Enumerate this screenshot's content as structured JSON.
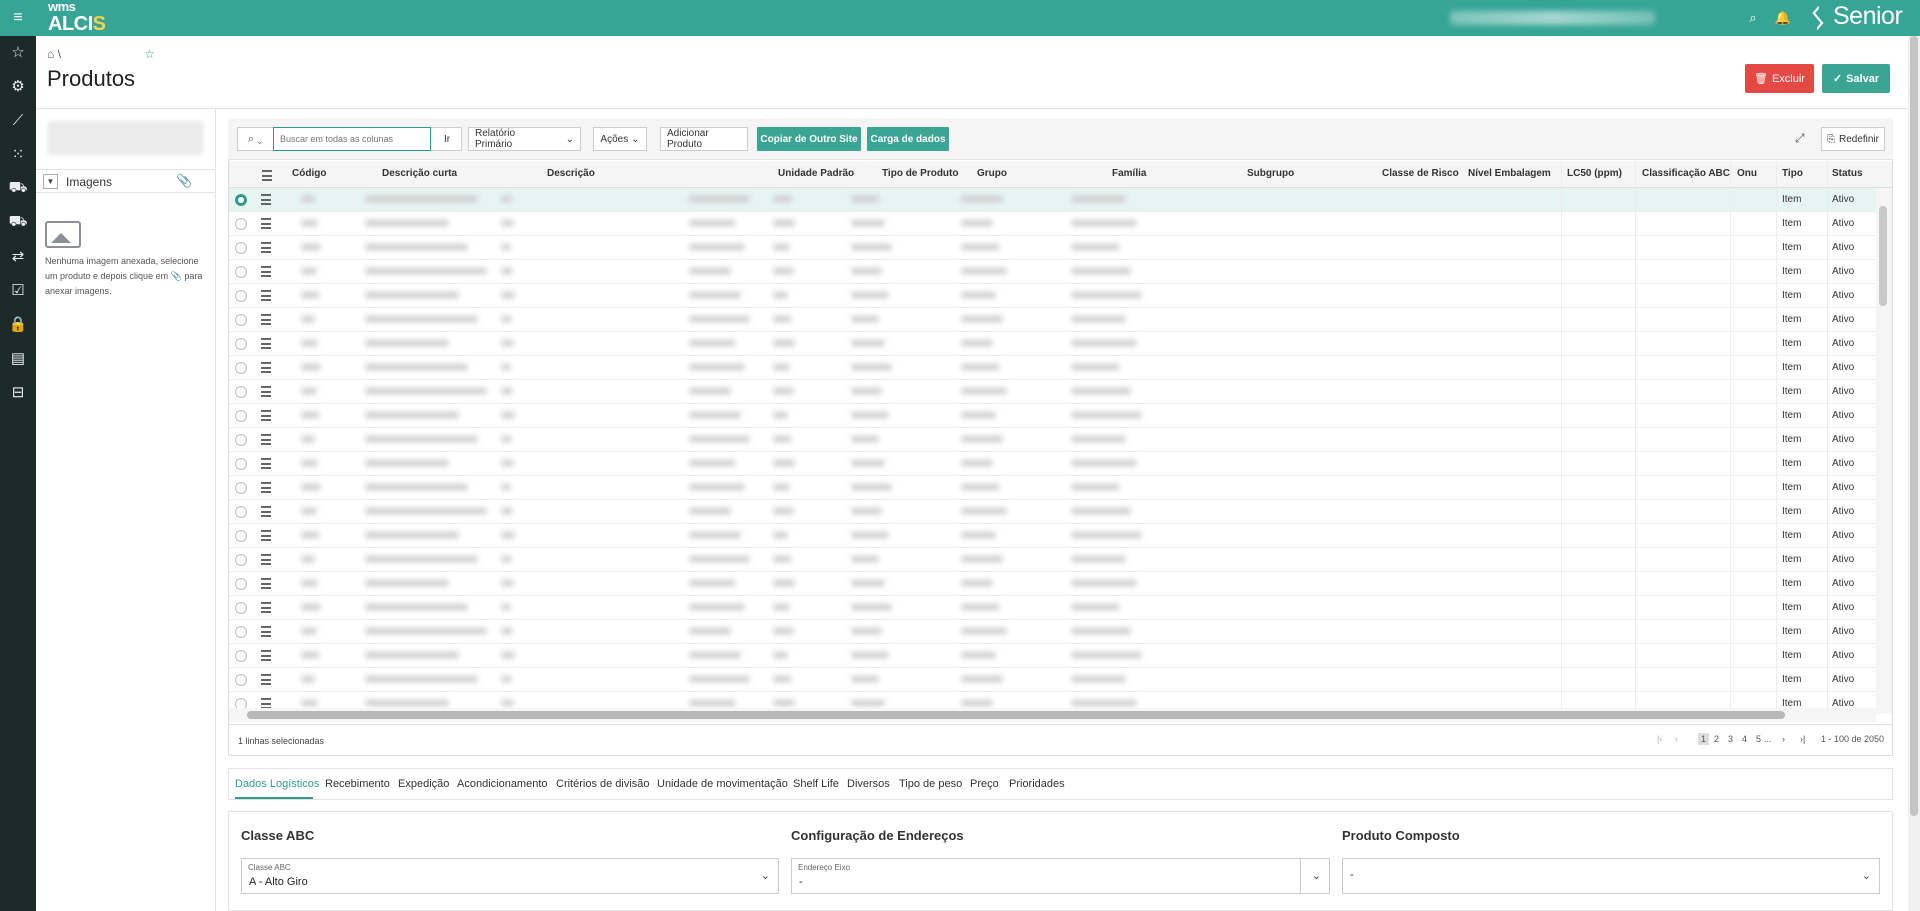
{
  "app": {
    "logo_top": "wms",
    "logo_main": "ALCI",
    "logo_accent": "S",
    "brand": "Senior"
  },
  "breadcrumb": {
    "sep": "\\"
  },
  "page": {
    "title": "Produtos",
    "delete_label": "Excluir",
    "save_label": "Salvar"
  },
  "images_panel": {
    "title": "Imagens",
    "text_a": "Nenhuma imagem anexada, selecione um produto e depois clique em",
    "text_b": "para anexar imagens."
  },
  "toolbar": {
    "search_placeholder": "Buscar em todas as colunas",
    "go_label": "Ir",
    "report_label": "Relatório Primário",
    "actions_label": "Ações",
    "add_label": "Adicionar Produto",
    "copy_label": "Copiar de Outro Site",
    "load_label": "Carga de dados",
    "reset_label": "Redefinir"
  },
  "columns": [
    "Código",
    "Descrição curta",
    "Descrição",
    "Unidade Padrão",
    "Tipo de Produto",
    "Grupo",
    "Família",
    "Subgrupo",
    "Classe de Risco",
    "Nível Embalagem",
    "LC50 (ppm)",
    "Classificação ABC",
    "Onu",
    "Tipo",
    "Status"
  ],
  "row_values": {
    "tipo": "Item",
    "status": "Ativo"
  },
  "footer": {
    "selected": "1 linhas selecionadas",
    "pages": [
      "1",
      "2",
      "3",
      "4",
      "5"
    ],
    "ellipsis": "...",
    "range": "1 - 100 de 2050"
  },
  "tabs": [
    "Dados Logísticos",
    "Recebimento",
    "Expedição",
    "Acondicionamento",
    "Critérios de divisão",
    "Unidade de movimentação",
    "Shelf Life",
    "Diversos",
    "Tipo de peso",
    "Preço",
    "Prioridades"
  ],
  "form": {
    "classe_title": "Classe ABC",
    "classe_label": "Classe ABC",
    "classe_value": "A - Alto Giro",
    "config_title": "Configuração de Endereços",
    "eixo_label": "Endereço Eixo",
    "eixo_value": "-",
    "composto_title": "Produto Composto",
    "composto_value": "-"
  },
  "colors": {
    "accent": "#37a596",
    "danger": "#e44a43",
    "sidebar": "#1e2a28"
  }
}
